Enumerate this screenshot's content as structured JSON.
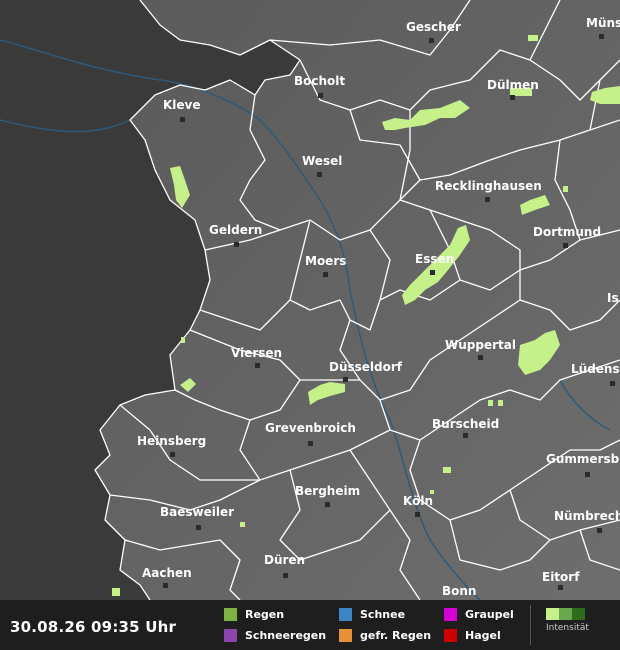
{
  "cities": [
    {
      "id": "gescher",
      "name": "Gescher"
    },
    {
      "id": "muenster",
      "name": "Müns"
    },
    {
      "id": "bocholt",
      "name": "Bocholt"
    },
    {
      "id": "duelmen",
      "name": "Dülmen"
    },
    {
      "id": "kleve",
      "name": "Kleve"
    },
    {
      "id": "wesel",
      "name": "Wesel"
    },
    {
      "id": "recklinghausen",
      "name": "Recklinghausen"
    },
    {
      "id": "geldern",
      "name": "Geldern"
    },
    {
      "id": "dortmund",
      "name": "Dortmund"
    },
    {
      "id": "moers",
      "name": "Moers"
    },
    {
      "id": "essen",
      "name": "Essen"
    },
    {
      "id": "is",
      "name": "Is"
    },
    {
      "id": "viersen",
      "name": "Viersen"
    },
    {
      "id": "wuppertal",
      "name": "Wuppertal"
    },
    {
      "id": "duesseldorf",
      "name": "Düsseldorf"
    },
    {
      "id": "luedenscheid",
      "name": "Lüdens"
    },
    {
      "id": "grevenbroich",
      "name": "Grevenbroich"
    },
    {
      "id": "burscheid",
      "name": "Burscheid"
    },
    {
      "id": "heinsberg",
      "name": "Heinsberg"
    },
    {
      "id": "gummersbach",
      "name": "Gummersb"
    },
    {
      "id": "bergheim",
      "name": "Bergheim"
    },
    {
      "id": "koeln",
      "name": "Köln"
    },
    {
      "id": "baesweiler",
      "name": "Baesweiler"
    },
    {
      "id": "nuembrecht",
      "name": "Nümbrech"
    },
    {
      "id": "dueren",
      "name": "Düren"
    },
    {
      "id": "aachen",
      "name": "Aachen"
    },
    {
      "id": "eitorf",
      "name": "Eitorf"
    },
    {
      "id": "bonn",
      "name": "Bonn"
    }
  ],
  "legend": {
    "timestamp": "30.08.26 09:35 Uhr",
    "items": [
      {
        "label": "Regen",
        "color": "#7cb342"
      },
      {
        "label": "Schneeregen",
        "color": "#8e44ad"
      },
      {
        "label": "Schnee",
        "color": "#3d85c6"
      },
      {
        "label": "gefr. Regen",
        "color": "#e69138"
      },
      {
        "label": "Graupel",
        "color": "#d400d4"
      },
      {
        "label": "Hagel",
        "color": "#cc0000"
      }
    ],
    "intensity_label": "Intensität",
    "intensity_colors": [
      "#c5f08a",
      "#6aa84f",
      "#2e6b1a"
    ]
  },
  "colors": {
    "land_inside": "#6b6b6b",
    "land_outside": "#3f3f3f",
    "borders": "#ffffff",
    "rain": "#c5f08a",
    "water": "#2f5a78"
  }
}
